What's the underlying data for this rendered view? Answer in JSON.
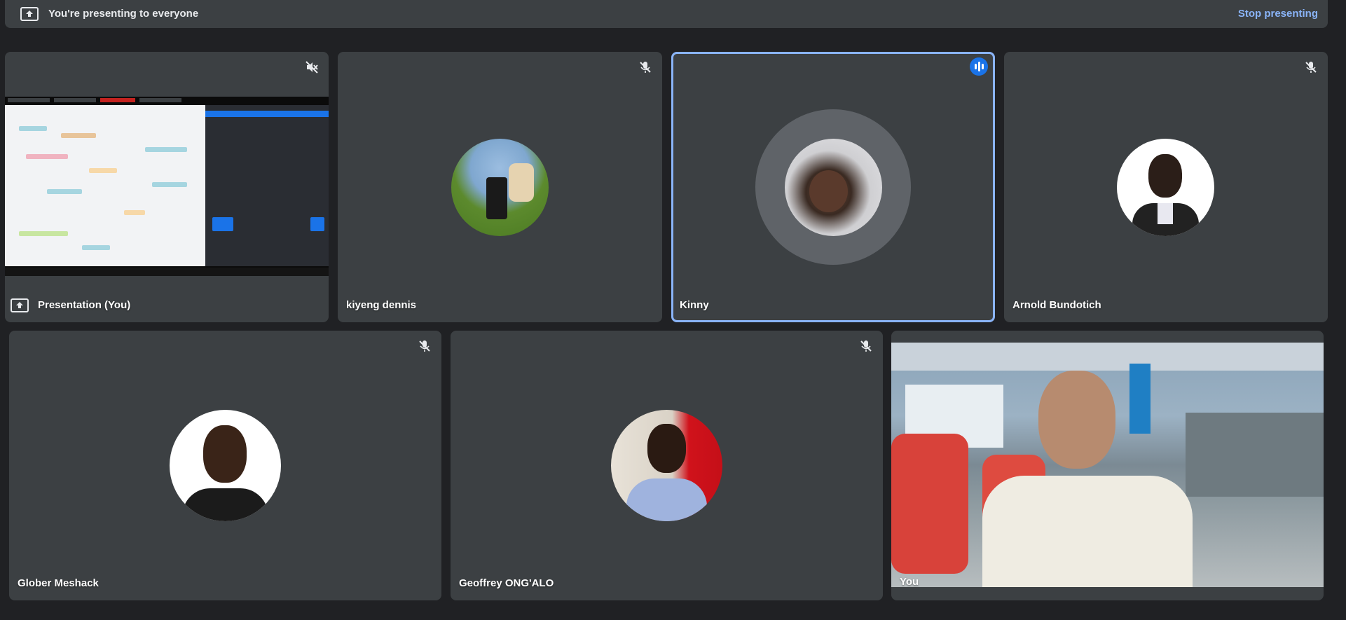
{
  "banner": {
    "title": "You're presenting to everyone",
    "stop_label": "Stop presenting"
  },
  "tiles": [
    {
      "name": "Presentation (You)",
      "mic": "speaker-muted-icon"
    },
    {
      "name": "kiyeng dennis",
      "mic": "mic-off-icon"
    },
    {
      "name": "Kinny",
      "mic": "speaking-indicator-icon"
    },
    {
      "name": "Arnold Bundotich",
      "mic": "mic-off-icon"
    },
    {
      "name": "Glober Meshack",
      "mic": "mic-off-icon"
    },
    {
      "name": "Geoffrey ONG'ALO",
      "mic": "mic-off-icon"
    },
    {
      "name": "You",
      "mic": ""
    }
  ],
  "colors": {
    "background": "#202124",
    "tile": "#3c4043",
    "accent": "#8ab4f8",
    "speaking": "#1a73e8"
  }
}
